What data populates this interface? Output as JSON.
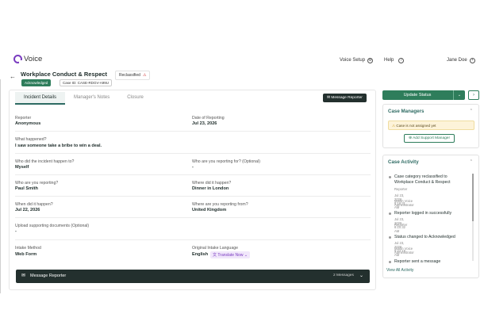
{
  "nav": {
    "brand": "Voice",
    "voice_setup": "Voice Setup",
    "help": "Help",
    "user": "Jane Doe"
  },
  "case": {
    "title": "Workplace Conduct & Respect",
    "reclassified": "Reclassified",
    "status_badge": "Acknowledged",
    "case_id": "Case ID: CASE-RDGV-A99U"
  },
  "tabs": [
    "Incident Details",
    "Manager's Notes",
    "Closure"
  ],
  "message_reporter_btn": "Message Reporter",
  "fields": {
    "reporter_label": "Reporter",
    "reporter_value": "Anonymous",
    "date_label": "Date of Reporting",
    "date_value": "Jul 23, 2026",
    "what_label": "What happened?",
    "what_value": "I saw someone take a bribe to win a deal.",
    "who_happen_label": "Who did the incident happen to?",
    "who_happen_value": "Myself",
    "reporting_for_label": "Who are you reporting for? (Optional)",
    "reporting_for_value": "-",
    "who_reporting_label": "Who are you reporting?",
    "who_reporting_value": "Paul Smith",
    "where_label": "Where did it happen?",
    "where_value": "Dinner in London",
    "when_label": "When did it happen?",
    "when_value": "Jul 22, 2026",
    "from_label": "Where are you reporting from?",
    "from_value": "United Kingdom",
    "upload_label": "Upload supporting documents (Optional)",
    "upload_value": "-",
    "intake_label": "Intake Method",
    "intake_value": "Web Form",
    "lang_label": "Original Intake Language",
    "lang_value": "English",
    "translate": "Translate Now"
  },
  "message_bar": {
    "title": "Message Reporter",
    "count": "2 Messages"
  },
  "update_status": "Update Status",
  "case_managers": {
    "title": "Case Managers",
    "notice": "Case is not assigned yet",
    "add": "Add Support Manager"
  },
  "activity": {
    "title": "Case Activity",
    "items": [
      {
        "headline": "Case category reclassified to Workplace Conduct & Respect",
        "date": "Jul 23, 2026, 8:16:31 AM",
        "source": "Reporter",
        "actor": "Martin Voice Administrator"
      },
      {
        "headline": "Reporter logged in successfully",
        "date": "Jul 23, 2026, 8:10:32 AM",
        "actor": "Reporter"
      },
      {
        "headline": "Status changed to Acknowledged",
        "date": "Jul 23, 2026, 9:22:18 AM",
        "actor": "Martin Voice Administrator"
      },
      {
        "headline": "Reporter sent a message"
      }
    ],
    "view_all": "View All Activity"
  }
}
